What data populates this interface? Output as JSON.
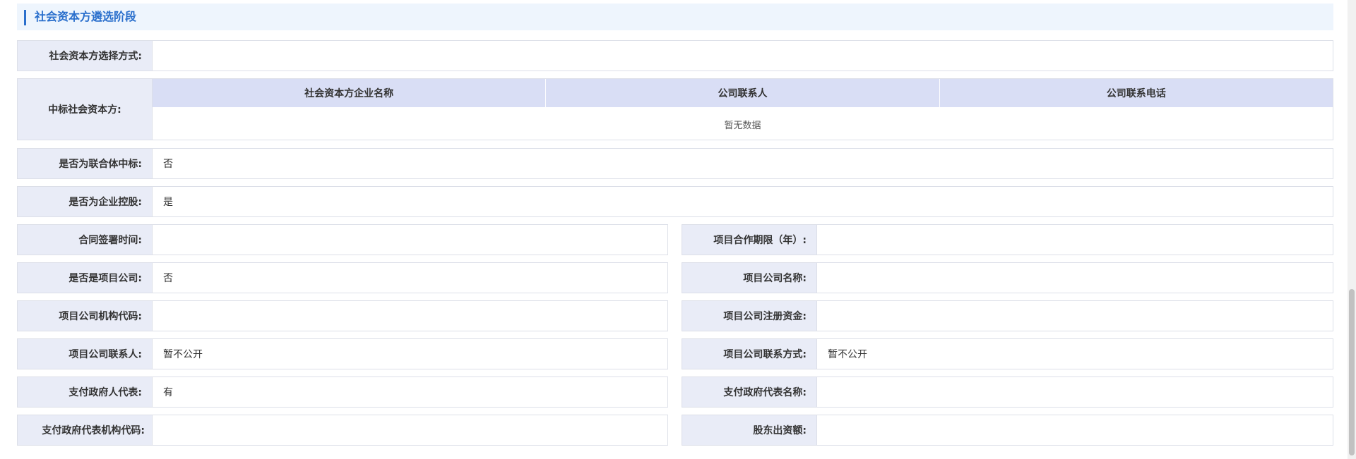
{
  "section": {
    "title": "社会资本方遴选阶段"
  },
  "fields": {
    "selection_method": {
      "label": "社会资本方选择方式:",
      "value": ""
    },
    "winning_bidder": {
      "label": "中标社会资本方:",
      "columns": [
        "社会资本方企业名称",
        "公司联系人",
        "公司联系电话"
      ],
      "empty_text": "暂无数据"
    },
    "consortium": {
      "label": "是否为联合体中标:",
      "value": "否"
    },
    "enterprise_holding": {
      "label": "是否为企业控股:",
      "value": "是"
    },
    "contract_date": {
      "label": "合同签署时间:",
      "value": ""
    },
    "cooperation_period": {
      "label": "项目合作期限（年）:",
      "value": ""
    },
    "is_project_company": {
      "label": "是否是项目公司:",
      "value": "否"
    },
    "project_company_name": {
      "label": "项目公司名称:",
      "value": ""
    },
    "org_code": {
      "label": "项目公司机构代码:",
      "value": ""
    },
    "registered_capital": {
      "label": "项目公司注册资金:",
      "value": ""
    },
    "company_contact": {
      "label": "项目公司联系人:",
      "value": "暂不公开"
    },
    "company_contact_method": {
      "label": "项目公司联系方式:",
      "value": "暂不公开"
    },
    "gov_representative": {
      "label": "支付政府人代表:",
      "value": "有"
    },
    "gov_rep_name": {
      "label": "支付政府代表名称:",
      "value": ""
    },
    "gov_rep_org_code": {
      "label": "支付政府代表机构代码:",
      "value": ""
    },
    "shareholder_contribution": {
      "label": "股东出资额:",
      "value": ""
    }
  },
  "colors": {
    "accent": "#2a6fcc",
    "label_bg": "#e9ecf7",
    "header_bg": "#d9def5",
    "section_bg": "#eef5fd"
  }
}
